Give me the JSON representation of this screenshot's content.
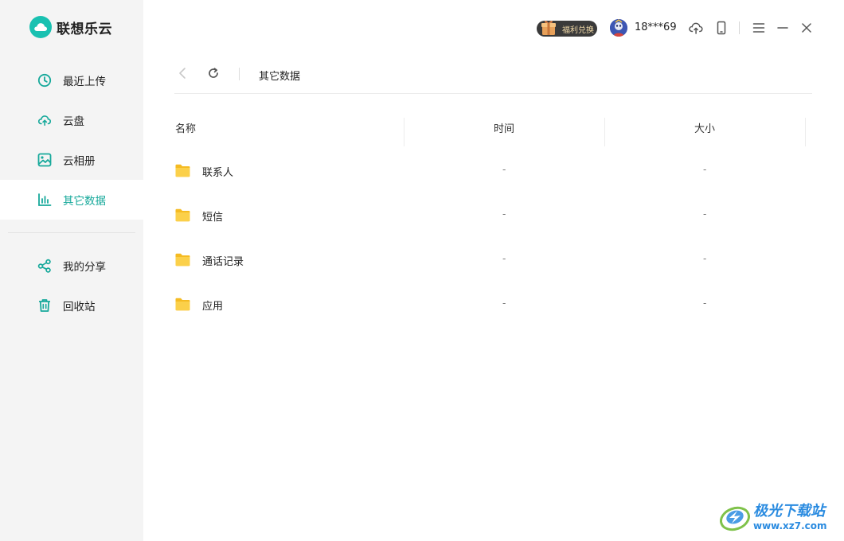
{
  "app": {
    "name": "联想乐云"
  },
  "sidebar": {
    "items": [
      {
        "label": "最近上传",
        "icon": "clock-icon"
      },
      {
        "label": "云盘",
        "icon": "cloud-upload-icon"
      },
      {
        "label": "云相册",
        "icon": "photo-icon"
      },
      {
        "label": "其它数据",
        "icon": "bar-chart-icon",
        "active": true
      }
    ],
    "secondary_items": [
      {
        "label": "我的分享",
        "icon": "share-icon"
      },
      {
        "label": "回收站",
        "icon": "trash-icon"
      }
    ]
  },
  "header": {
    "badge_label": "福利兑换",
    "username": "18***69"
  },
  "toolbar": {
    "breadcrumb": "其它数据"
  },
  "table": {
    "columns": [
      "名称",
      "时间",
      "大小"
    ],
    "rows": [
      {
        "name": "联系人",
        "time": "-",
        "size": "-"
      },
      {
        "name": "短信",
        "time": "-",
        "size": "-"
      },
      {
        "name": "通话记录",
        "time": "-",
        "size": "-"
      },
      {
        "name": "应用",
        "time": "-",
        "size": "-"
      }
    ]
  },
  "watermark": {
    "title": "极光下载站",
    "url": "www.xz7.com"
  },
  "colors": {
    "accent": "#17a99b",
    "sidebar_bg": "#f4f4f4",
    "folder": "#f7c531"
  }
}
